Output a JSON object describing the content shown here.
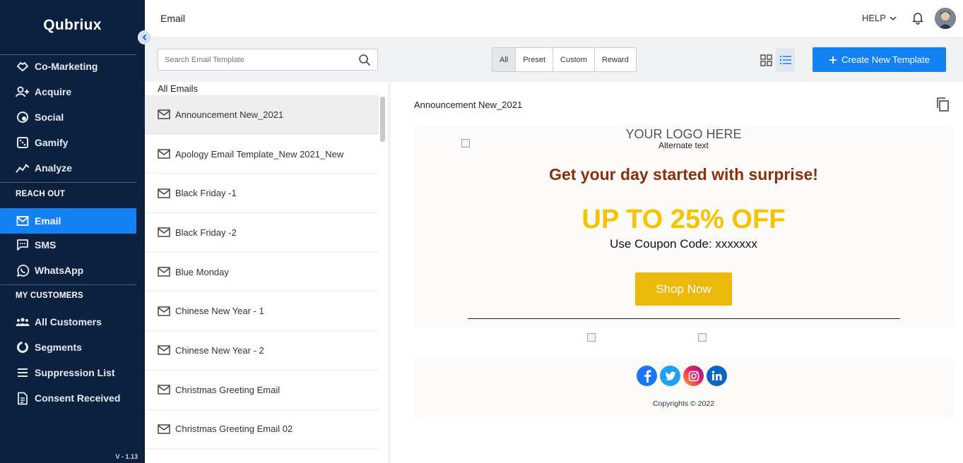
{
  "app": {
    "logo": "Qubriux",
    "version": "V - 1.13"
  },
  "sidebar": {
    "items": [
      {
        "label": "Co-Marketing",
        "icon": "handshake-icon"
      },
      {
        "label": "Acquire",
        "icon": "add-user-icon"
      },
      {
        "label": "Social",
        "icon": "social-globe-icon"
      },
      {
        "label": "Gamify",
        "icon": "dice-icon"
      },
      {
        "label": "Analyze",
        "icon": "analytics-icon"
      }
    ],
    "reach_out_title": "REACH OUT",
    "reach_out": [
      {
        "label": "Email",
        "icon": "mail-icon"
      },
      {
        "label": "SMS",
        "icon": "sms-icon"
      },
      {
        "label": "WhatsApp",
        "icon": "whatsapp-icon"
      }
    ],
    "customers_title": "MY CUSTOMERS",
    "customers": [
      {
        "label": "All Customers",
        "icon": "group-icon"
      },
      {
        "label": "Segments",
        "icon": "segments-icon"
      },
      {
        "label": "Suppression List",
        "icon": "list-icon"
      },
      {
        "label": "Consent Received",
        "icon": "document-icon"
      }
    ]
  },
  "header": {
    "title": "Email",
    "help": "HELP"
  },
  "toolbar": {
    "search_placeholder": "Search Email Template",
    "filters": [
      "All",
      "Preset",
      "Custom",
      "Reward"
    ],
    "active_filter": "All",
    "create_label": "Create New Template"
  },
  "list": {
    "header": "All Emails",
    "items": [
      "Announcement New_2021",
      "Apology Email Template_New 2021_New",
      "Black Friday -1",
      "Black Friday -2",
      "Blue Monday",
      "Chinese New Year - 1",
      "Chinese New Year - 2",
      "Christmas Greeting Email",
      "Christmas Greeting Email 02"
    ],
    "selected_index": 0
  },
  "preview": {
    "title": "Announcement New_2021",
    "logo_text": "YOUR LOGO HERE",
    "alt_text": "Alternate text",
    "headline": "Get your day started with surprise!",
    "offer": "UP TO 25% OFF",
    "coupon": "Use Coupon Code: xxxxxxx",
    "button": "Shop Now",
    "socials": [
      "facebook-icon",
      "twitter-icon",
      "instagram-icon",
      "linkedin-icon"
    ],
    "copyright": "Copyrights © 2022"
  },
  "colors": {
    "sidebar_bg": "#0c2040",
    "accent": "#1481f2",
    "headline": "#8b2f0c",
    "offer": "#f5c300",
    "shop_button": "#ecb80a"
  }
}
